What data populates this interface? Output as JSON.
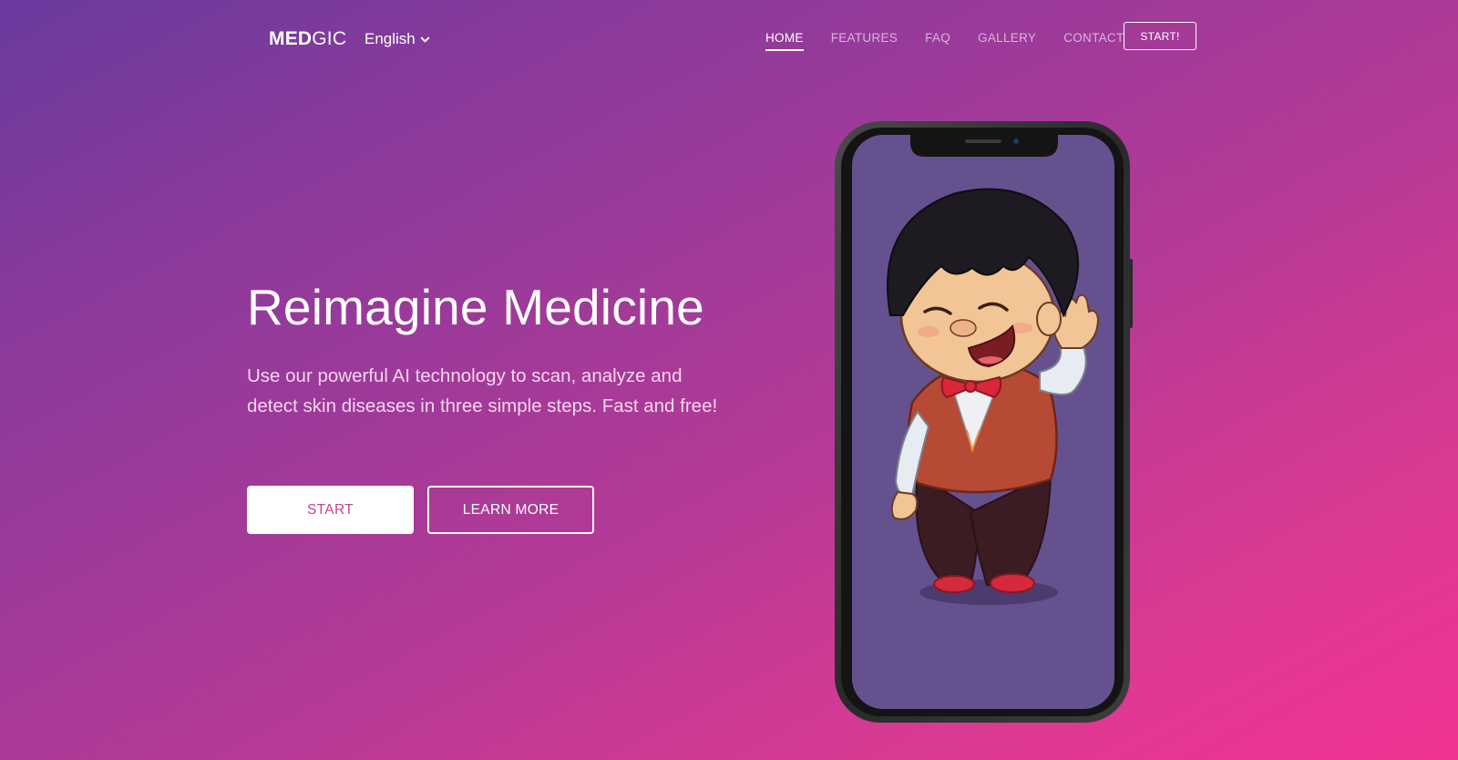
{
  "brand": {
    "logo_bold": "MED",
    "logo_light": "GIC"
  },
  "language": {
    "selected": "English",
    "icon": "chevron-down-icon"
  },
  "nav": {
    "items": [
      {
        "label": "HOME",
        "active": true
      },
      {
        "label": "FEATURES",
        "active": false
      },
      {
        "label": "FAQ",
        "active": false
      },
      {
        "label": "GALLERY",
        "active": false
      },
      {
        "label": "CONTACT",
        "active": false
      }
    ],
    "cta_label": "START!"
  },
  "hero": {
    "title": "Reimagine Medicine",
    "description": "Use our powerful AI technology to scan, analyze and detect skin diseases in three simple steps. Fast and free!",
    "primary_button": "START",
    "secondary_button": "LEARN MORE"
  },
  "colors": {
    "gradient_start": "#6a3a9e",
    "gradient_end": "#f23392",
    "phone_screen": "#66518f",
    "start_button_text": "#c74294"
  }
}
